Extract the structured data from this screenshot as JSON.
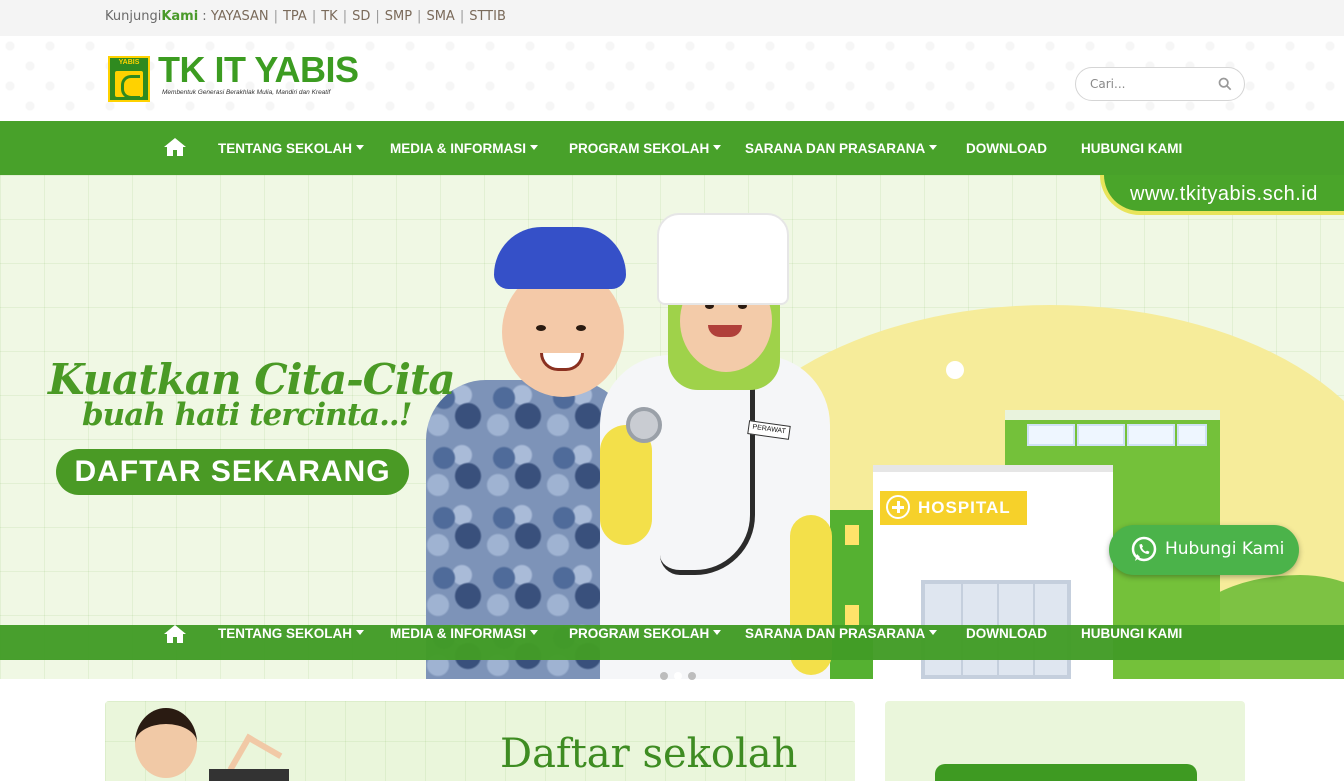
{
  "topbar": {
    "prefix": "Kunjungi",
    "prefix_bold": "Kami",
    "colon": " : ",
    "links": [
      "YAYASAN",
      "TPA",
      "TK",
      "SD",
      "SMP",
      "SMA",
      "STTIB"
    ],
    "separator": "|"
  },
  "brand": {
    "emblem_text": "YABIS",
    "title": "TK IT YABIS",
    "tagline": "Membentuk Generasi Berakhlak Mulia, Mandiri dan Kreatif",
    "color": "#3c9c21"
  },
  "search": {
    "placeholder": "Cari...",
    "icon": "search-icon"
  },
  "nav": {
    "home_icon": "home-icon",
    "items": [
      {
        "label": "TENTANG SEKOLAH",
        "has_dropdown": true
      },
      {
        "label": "MEDIA & INFORMASI",
        "has_dropdown": true
      },
      {
        "label": "PROGRAM SEKOLAH",
        "has_dropdown": true
      },
      {
        "label": "SARANA DAN PRASARANA",
        "has_dropdown": true
      },
      {
        "label": "DOWNLOAD",
        "has_dropdown": false
      },
      {
        "label": "HUBUNGI KAMI",
        "has_dropdown": false
      }
    ],
    "color": "#48a12a"
  },
  "hero": {
    "url": "www.tkityabis.sch.id",
    "headline_line1": "Kuatkan Cita-Cita",
    "headline_line2": "buah hati tercinta..!",
    "cta_label": "DAFTAR SEKARANG",
    "hospital_label": "HOSPITAL",
    "badge_name": "PERAWAT",
    "carousel_dots": 3,
    "active_dot": 1
  },
  "whatsapp": {
    "label": "Hubungi Kami",
    "icon": "whatsapp-icon",
    "color": "#4bb34a"
  },
  "cards": {
    "left_title": "Daftar sekolah"
  }
}
